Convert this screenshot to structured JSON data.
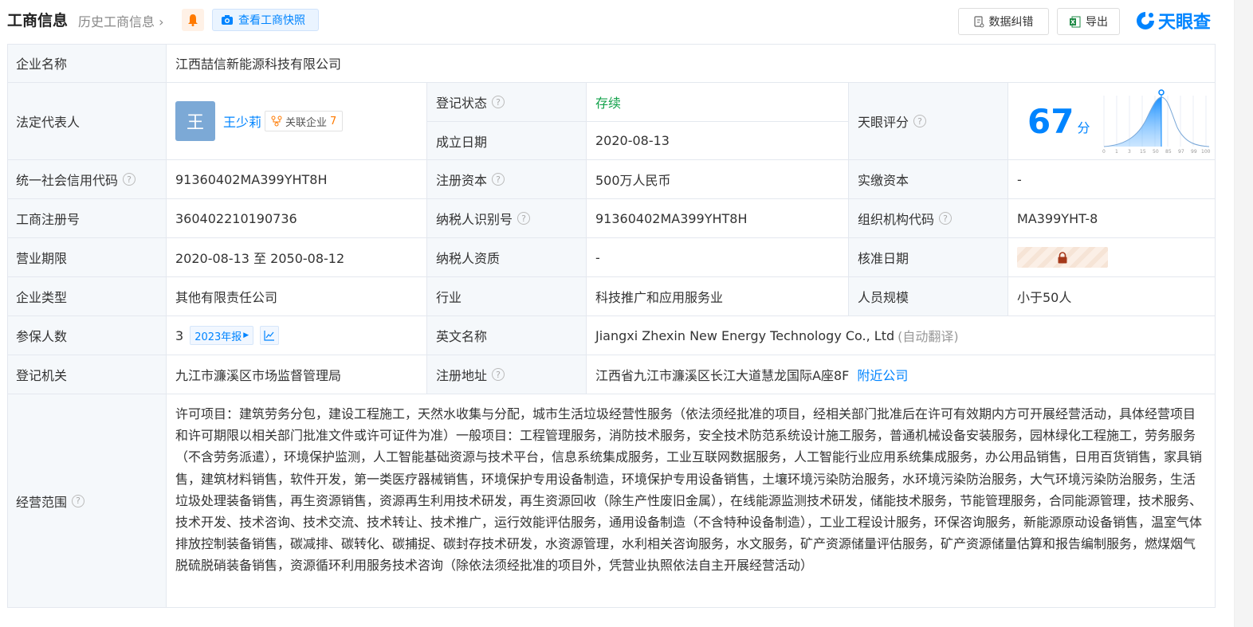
{
  "header": {
    "title": "工商信息",
    "history": "历史工商信息",
    "snapshot": "查看工商快照",
    "correct": "数据纠错",
    "export": "导出",
    "logo": "天眼查",
    "accent": "#0084ff"
  },
  "rows": {
    "name": {
      "label": "企业名称",
      "value": "江西喆信新能源科技有限公司"
    },
    "legal": {
      "label": "法定代表人",
      "avatar": "王",
      "name": "王少莉",
      "rel_label": "关联企业",
      "rel_count": "7"
    },
    "reg_status": {
      "label": "登记状态",
      "value": "存续"
    },
    "found_date": {
      "label": "成立日期",
      "value": "2020-08-13"
    },
    "rating": {
      "label": "天眼评分",
      "score": "67",
      "unit": "分",
      "scale": [
        "0",
        "1",
        "3",
        "15",
        "50",
        "85",
        "97",
        "99",
        "100"
      ]
    },
    "credit_code": {
      "label": "统一社会信用代码",
      "value": "91360402MA399YHT8H"
    },
    "reg_capital": {
      "label": "注册资本",
      "value": "500万人民币"
    },
    "paid_capital": {
      "label": "实缴资本",
      "value": "-"
    },
    "biz_reg_no": {
      "label": "工商注册号",
      "value": "360402210190736"
    },
    "taxpayer_id": {
      "label": "纳税人识别号",
      "value": "91360402MA399YHT8H"
    },
    "org_code": {
      "label": "组织机构代码",
      "value": "MA399YHT-8"
    },
    "term": {
      "label": "营业期限",
      "value": "2020-08-13 至 2050-08-12"
    },
    "tax_qual": {
      "label": "纳税人资质",
      "value": "-"
    },
    "approve_date": {
      "label": "核准日期"
    },
    "type": {
      "label": "企业类型",
      "value": "其他有限责任公司"
    },
    "industry": {
      "label": "行业",
      "value": "科技推广和应用服务业"
    },
    "staff": {
      "label": "人员规模",
      "value": "小于50人"
    },
    "insured": {
      "label": "参保人数",
      "value": "3",
      "report": "2023年报"
    },
    "en_name": {
      "label": "英文名称",
      "value": "Jiangxi Zhexin New Energy Technology Co., Ltd",
      "note": "(自动翻译)"
    },
    "authority": {
      "label": "登记机关",
      "value": "九江市濂溪区市场监督管理局"
    },
    "address": {
      "label": "注册地址",
      "value": "江西省九江市濂溪区长江大道慧龙国际A座8F",
      "link": "附近公司"
    },
    "scope": {
      "label": "经营范围",
      "value": "许可项目：建筑劳务分包，建设工程施工，天然水收集与分配，城市生活垃圾经营性服务（依法须经批准的项目，经相关部门批准后在许可有效期内方可开展经营活动，具体经营项目和许可期限以相关部门批准文件或许可证件为准）一般项目：工程管理服务，消防技术服务，安全技术防范系统设计施工服务，普通机械设备安装服务，园林绿化工程施工，劳务服务（不含劳务派遣），环境保护监测，人工智能基础资源与技术平台，信息系统集成服务，工业互联网数据服务，人工智能行业应用系统集成服务，办公用品销售，日用百货销售，家具销售，建筑材料销售，软件开发，第一类医疗器械销售，环境保护专用设备制造，环境保护专用设备销售，土壤环境污染防治服务，水环境污染防治服务，大气环境污染防治服务，生活垃圾处理装备销售，再生资源销售，资源再生利用技术研发，再生资源回收（除生产性废旧金属），在线能源监测技术研发，储能技术服务，节能管理服务，合同能源管理，技术服务、技术开发、技术咨询、技术交流、技术转让、技术推广，运行效能评估服务，通用设备制造（不含特种设备制造），工业工程设计服务，环保咨询服务，新能源原动设备销售，温室气体排放控制装备销售，碳减排、碳转化、碳捕捉、碳封存技术研发，水资源管理，水利相关咨询服务，水文服务，矿产资源储量评估服务，矿产资源储量估算和报告编制服务，燃煤烟气脱硫脱硝装备销售，资源循环利用服务技术咨询（除依法须经批准的项目外，凭营业执照依法自主开展经营活动）"
    }
  }
}
